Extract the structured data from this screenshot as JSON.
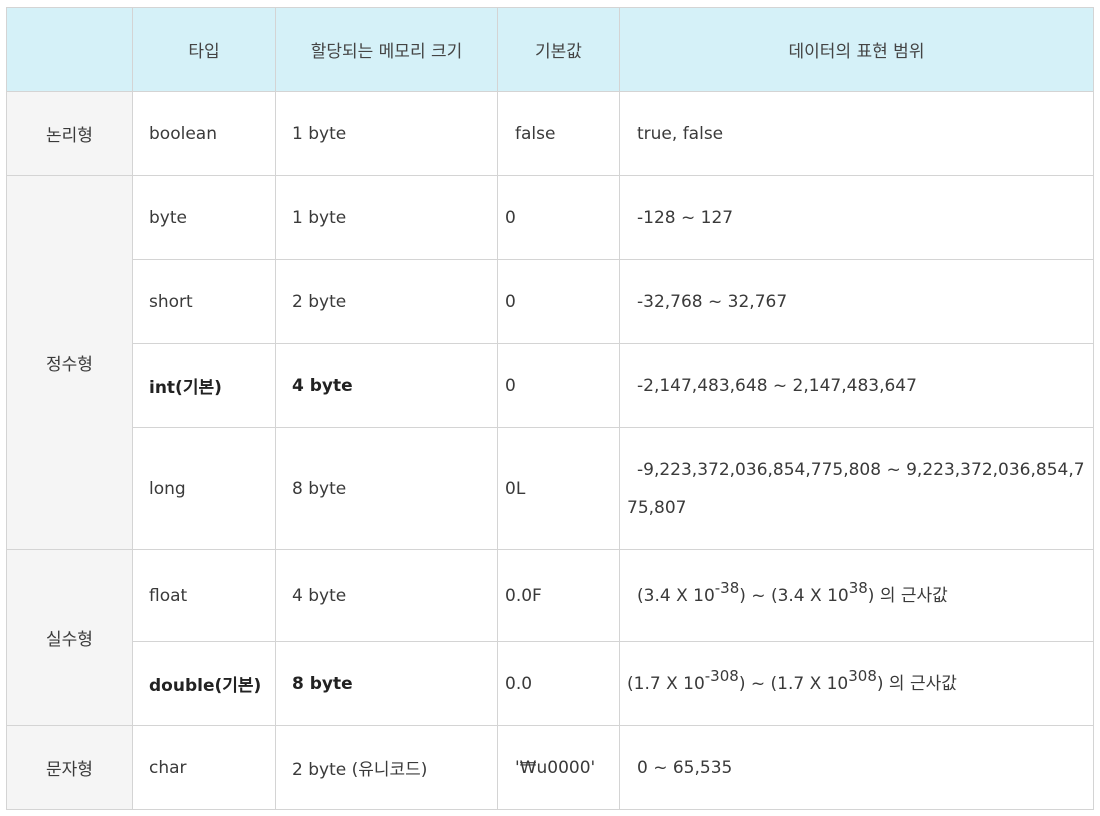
{
  "headers": [
    "",
    "타입",
    "할당되는 메모리 크기",
    "기본값",
    "데이터의 표현 범위"
  ],
  "groups": {
    "logical": "논리형",
    "integer": "정수형",
    "real": "실수형",
    "char": "문자형"
  },
  "rows": {
    "boolean": {
      "type": "boolean",
      "size": "1 byte",
      "default": "false",
      "range": "true, false"
    },
    "byte": {
      "type": "byte",
      "size": "1 byte",
      "default": "0",
      "range": "-128 ~ 127"
    },
    "short": {
      "type": "short",
      "size": "2 byte",
      "default": "0",
      "range": "-32,768 ~ 32,767"
    },
    "int": {
      "type": "int(기본)",
      "size": "4 byte",
      "default": "0",
      "range": "-2,147,483,648 ~ 2,147,483,647"
    },
    "long": {
      "type": "long",
      "size": "8 byte",
      "default": "0L",
      "range": "-9,223,372,036,854,775,808 ~ 9,223,372,036,854,775,807"
    },
    "float": {
      "type": "float",
      "size": "4 byte",
      "default": "0.0F",
      "range_a": "(3.4 X 10",
      "range_a_exp": "-38",
      "range_b": ") ~ (3.4 X 10",
      "range_b_exp": "38",
      "range_c": ") 의 근사값"
    },
    "double": {
      "type": "double(기본)",
      "size": "8 byte",
      "default": "0.0",
      "range_a": "(1.7 X 10",
      "range_a_exp": "-308",
      "range_b": ") ~ (1.7 X 10",
      "range_b_exp": "308",
      "range_c": ") 의 근사값"
    },
    "char": {
      "type": "char",
      "size": "2 byte (유니코드)",
      "default": "'₩u0000'",
      "range": "0 ~ 65,535"
    }
  }
}
